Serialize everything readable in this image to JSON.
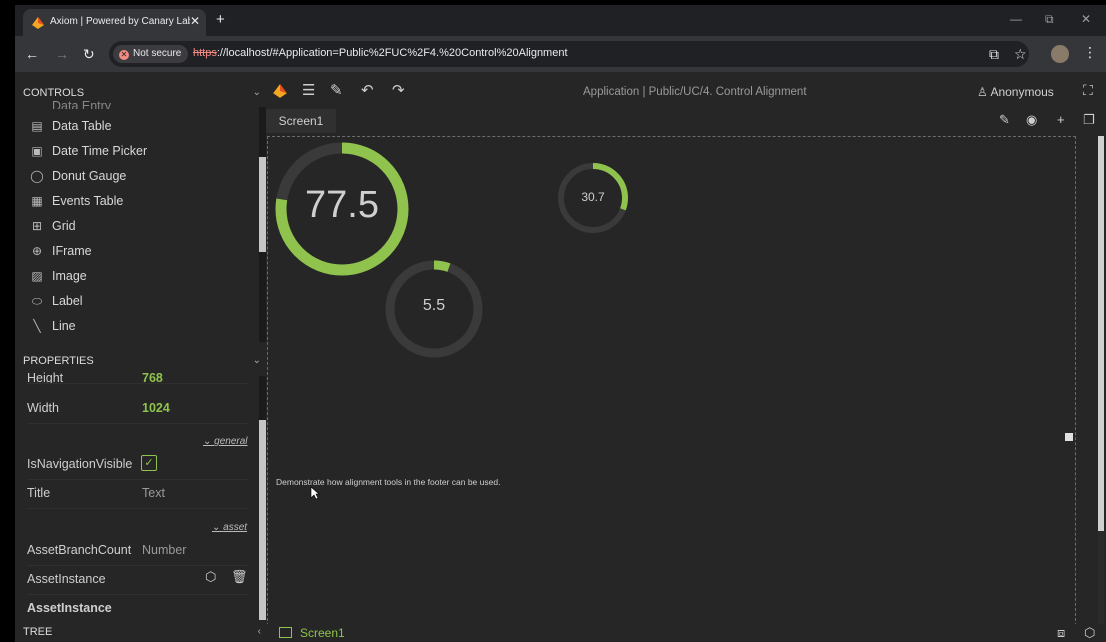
{
  "browser": {
    "tab_title": "Axiom | Powered by Canary Lab",
    "close_tab": "✕",
    "new_tab": "+",
    "window_controls": {
      "minimize": "—",
      "restore": "⧉",
      "close": "✕"
    },
    "nav": {
      "back": "←",
      "forward": "→",
      "reload": "↻"
    },
    "security_label": "Not secure",
    "url_scheme": "https",
    "url_rest": "://localhost/#Application=Public%2FUC%2F4.%20Control%20Alignment",
    "icons": {
      "install": "install-icon",
      "star": "star-icon",
      "menu": "kebab-menu-icon"
    }
  },
  "controls_panel": {
    "title": "CONTROLS",
    "partial_item": "Data Entry",
    "items": [
      {
        "label": "Data Table",
        "icon": "▤"
      },
      {
        "label": "Date Time Picker",
        "icon": "▣"
      },
      {
        "label": "Donut Gauge",
        "icon": "◯"
      },
      {
        "label": "Events Table",
        "icon": "▦"
      },
      {
        "label": "Grid",
        "icon": "⊞"
      },
      {
        "label": "IFrame",
        "icon": "⊕"
      },
      {
        "label": "Image",
        "icon": "▨"
      },
      {
        "label": "Label",
        "icon": "⬭"
      },
      {
        "label": "Line",
        "icon": "╲"
      }
    ]
  },
  "properties_panel": {
    "title": "PROPERTIES",
    "height_label": "Height",
    "height_value": "768",
    "width_label": "Width",
    "width_value": "1024",
    "section_general": "general",
    "nav_visible_label": "IsNavigationVisible",
    "nav_visible_checked": true,
    "title_label": "Title",
    "title_value": "Text",
    "section_asset": "asset",
    "asset_branch_label": "AssetBranchCount",
    "asset_branch_value": "Number",
    "asset_instance_label": "AssetInstance",
    "asset_instance_label2": "AssetInstance"
  },
  "tree_panel": {
    "title": "TREE"
  },
  "app_toolbar": {
    "breadcrumb": "Application | Public/UC/4. Control Alignment",
    "user": "Anonymous"
  },
  "screen_tab": "Screen1",
  "canvas": {
    "gauges": [
      {
        "value": "77.5",
        "fraction": 0.775
      },
      {
        "value": "30.7",
        "fraction": 0.307
      },
      {
        "value": "5.5",
        "fraction": 0.055
      }
    ],
    "note": "Demonstrate how alignment tools in the footer can be used."
  },
  "footer": {
    "tab": "Screen1"
  },
  "colors": {
    "accent": "#8fc34d",
    "track": "#3a3a3a",
    "background": "#262626"
  }
}
